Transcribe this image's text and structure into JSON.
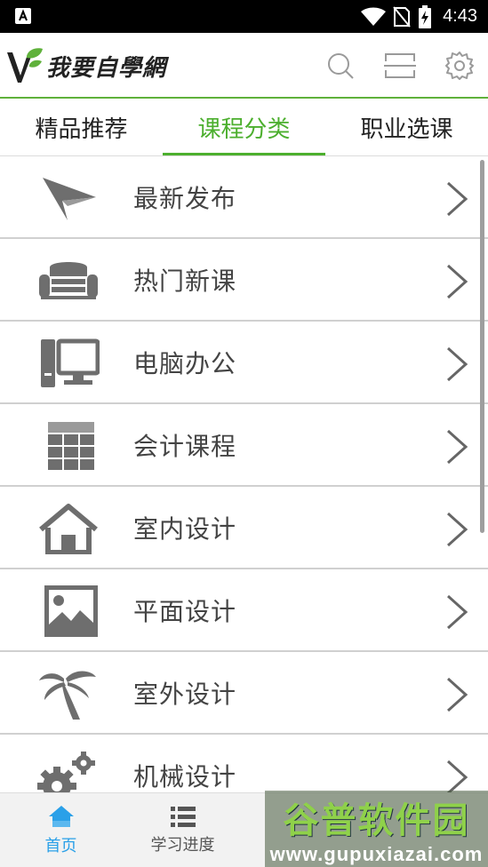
{
  "status_bar": {
    "time": "4:43"
  },
  "app": {
    "logo_text": "我要自學網"
  },
  "header_icons": [
    "search-icon",
    "scan-icon",
    "settings-icon"
  ],
  "tabs": [
    {
      "label": "精品推荐",
      "active": false
    },
    {
      "label": "课程分类",
      "active": true
    },
    {
      "label": "职业选课",
      "active": false
    }
  ],
  "categories": [
    {
      "label": "最新发布",
      "icon": "paper-plane-icon"
    },
    {
      "label": "热门新课",
      "icon": "sofa-icon"
    },
    {
      "label": "电脑办公",
      "icon": "computer-icon"
    },
    {
      "label": "会计课程",
      "icon": "spreadsheet-icon"
    },
    {
      "label": "室内设计",
      "icon": "house-icon"
    },
    {
      "label": "平面设计",
      "icon": "image-icon"
    },
    {
      "label": "室外设计",
      "icon": "palm-tree-icon"
    },
    {
      "label": "机械设计",
      "icon": "gears-icon"
    }
  ],
  "bottom_nav": [
    {
      "label": "首页",
      "active": true
    },
    {
      "label": "学习进度",
      "active": false
    },
    {
      "label": ""
    },
    {
      "label": ""
    }
  ],
  "watermark": {
    "main": "谷普软件园",
    "sub": "www.gupuxiazai.com"
  },
  "colors": {
    "accent_green": "#4caf2e",
    "nav_active_blue": "#2aa0e8",
    "icon_gray": "#6e6e6e"
  }
}
